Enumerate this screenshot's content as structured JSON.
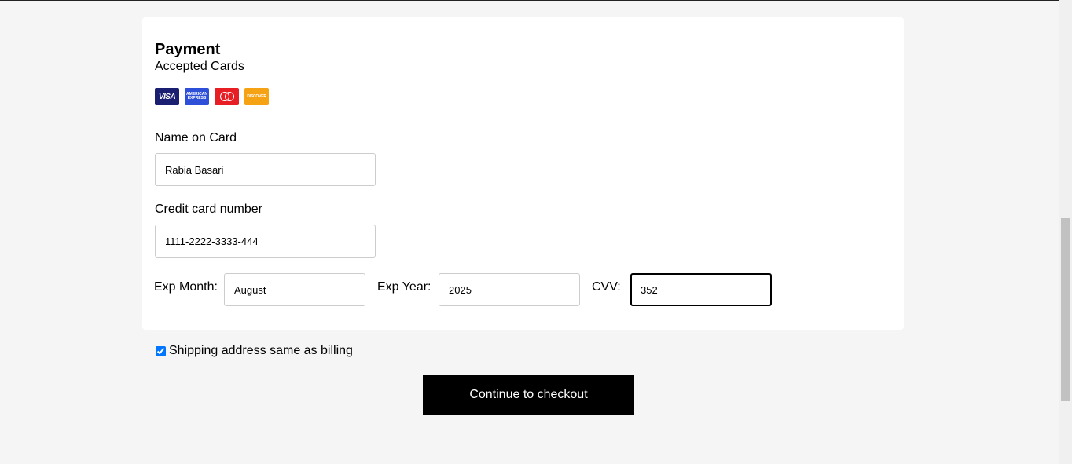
{
  "payment": {
    "title": "Payment",
    "subtitle": "Accepted Cards",
    "card_logos": {
      "visa": "VISA",
      "amex_line1": "AMERICAN",
      "amex_line2": "EXPRESS",
      "discover": "DISCOVER"
    }
  },
  "fields": {
    "name_label": "Name on Card",
    "name_value": "Rabia Basari",
    "card_label": "Credit card number",
    "card_value": "1111-2222-3333-444",
    "month_label": "Exp Month:",
    "month_value": "August",
    "year_label": "Exp Year:",
    "year_value": "2025",
    "cvv_label": "CVV:",
    "cvv_value": "352"
  },
  "shipping": {
    "label": "Shipping address same as billing",
    "checked": true
  },
  "checkout_button": "Continue to checkout",
  "colors": {
    "page_bg": "#f5f5f5",
    "card_bg": "#ffffff",
    "button_bg": "#000000",
    "visa": "#1a1f71",
    "amex": "#2e4fd8",
    "mastercard": "#e81e25",
    "discover": "#f5a214",
    "checkbox_accent": "#0075ff"
  }
}
